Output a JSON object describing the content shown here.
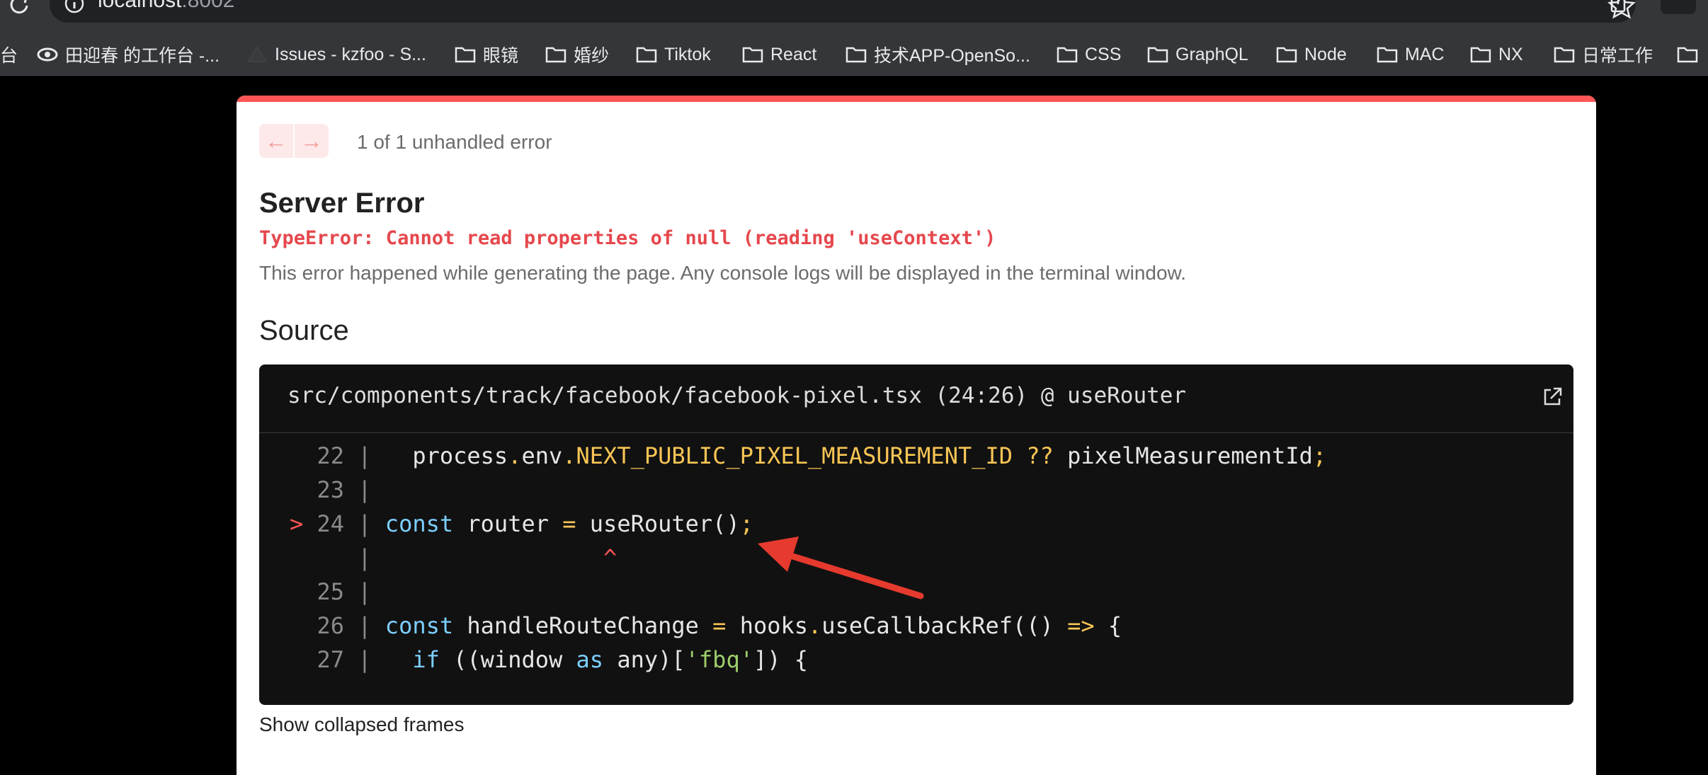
{
  "browser": {
    "url_host": "localhost",
    "url_port": ":8002"
  },
  "bookmarks": [
    {
      "label": "台",
      "icon": "none-icon"
    },
    {
      "label": "田迎春 的工作台 -...",
      "icon": "eye-icon"
    },
    {
      "label": "Issues - kzfoo - S...",
      "icon": "triangle-icon"
    },
    {
      "label": "眼镜",
      "icon": "folder-icon"
    },
    {
      "label": "婚纱",
      "icon": "folder-icon"
    },
    {
      "label": "Tiktok",
      "icon": "folder-icon"
    },
    {
      "label": "React",
      "icon": "folder-icon"
    },
    {
      "label": "技术APP-OpenSo...",
      "icon": "folder-icon"
    },
    {
      "label": "CSS",
      "icon": "folder-icon"
    },
    {
      "label": "GraphQL",
      "icon": "folder-icon"
    },
    {
      "label": "Node",
      "icon": "folder-icon"
    },
    {
      "label": "MAC",
      "icon": "folder-icon"
    },
    {
      "label": "NX",
      "icon": "folder-icon"
    },
    {
      "label": "日常工作",
      "icon": "folder-icon"
    }
  ],
  "overlay": {
    "accent_color": "#ff5555",
    "nav_prev": "←",
    "nav_next": "→",
    "counter": "1 of 1 unhandled error",
    "title": "Server Error",
    "error": "TypeError: Cannot read properties of null (reading 'useContext')",
    "description": "This error happened while generating the page. Any console logs will be displayed in the terminal window.",
    "source_heading": "Source",
    "file": "src/components/track/facebook/facebook-pixel.tsx (24:26) @ useRouter",
    "show_collapsed": "Show collapsed frames"
  },
  "code": {
    "lines": [
      {
        "n": "22",
        "marker": "",
        "parts": [
          [
            "",
            "  process"
          ],
          [
            "ye",
            "."
          ],
          [
            "",
            "env"
          ],
          [
            "ye",
            ".NEXT_PUBLIC_PIXEL_MEASUREMENT_ID ??"
          ],
          [
            "",
            " pixelMeasurementId"
          ],
          [
            "ye",
            ";"
          ]
        ]
      },
      {
        "n": "23",
        "marker": "",
        "parts": []
      },
      {
        "n": "24",
        "marker": ">",
        "parts": [
          [
            "kw",
            "const"
          ],
          [
            "",
            " router "
          ],
          [
            "ye",
            "="
          ],
          [
            "",
            " useRouter()"
          ],
          [
            "ye",
            ";"
          ]
        ]
      },
      {
        "n": "",
        "marker": "",
        "parts": [
          [
            "",
            "                "
          ],
          [
            "red",
            "^"
          ]
        ]
      },
      {
        "n": "25",
        "marker": "",
        "parts": []
      },
      {
        "n": "26",
        "marker": "",
        "parts": [
          [
            "kw",
            "const"
          ],
          [
            "",
            " handleRouteChange "
          ],
          [
            "ye",
            "="
          ],
          [
            "",
            " hooks"
          ],
          [
            "ye",
            "."
          ],
          [
            "",
            "useCallbackRef(() "
          ],
          [
            "ye",
            "=>"
          ],
          [
            "",
            " {"
          ]
        ]
      },
      {
        "n": "27",
        "marker": "",
        "parts": [
          [
            "",
            "  "
          ],
          [
            "kw",
            "if"
          ],
          [
            "",
            " ((window "
          ],
          [
            "kw",
            "as"
          ],
          [
            "",
            " any)["
          ],
          [
            "gr",
            "'fbq'"
          ],
          [
            "",
            "]) {"
          ]
        ]
      }
    ]
  }
}
